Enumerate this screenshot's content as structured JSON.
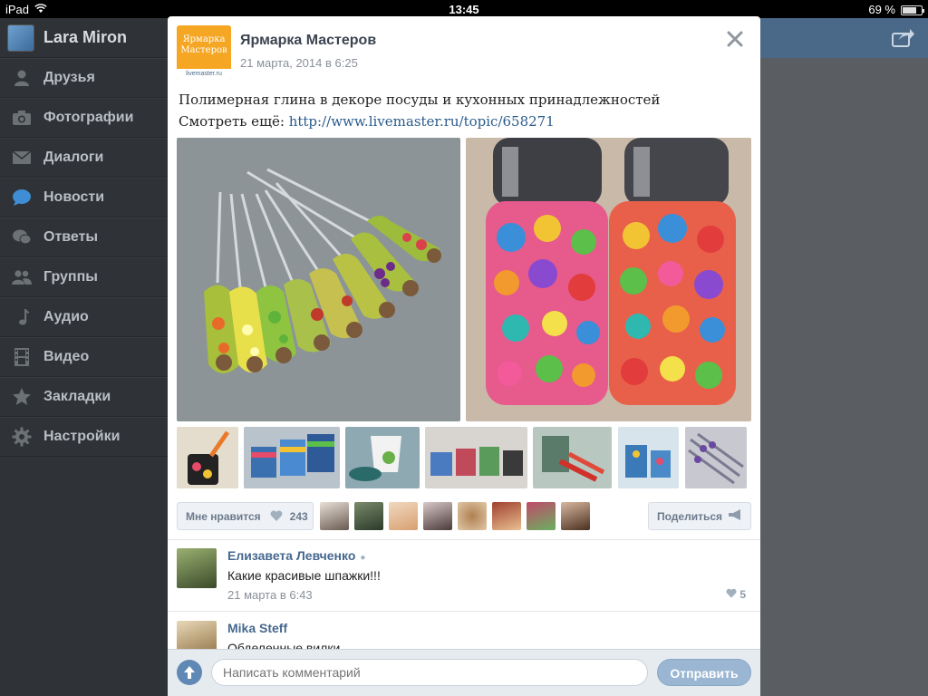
{
  "status_bar": {
    "carrier": "iPad",
    "time": "13:45",
    "battery": "69 %",
    "battery_level": 0.69
  },
  "sidebar": {
    "user_name": "Lara Miron",
    "items": [
      {
        "label": "Друзья",
        "icon": "person-icon"
      },
      {
        "label": "Фотографии",
        "icon": "camera-icon"
      },
      {
        "label": "Диалоги",
        "icon": "envelope-icon"
      },
      {
        "label": "Новости",
        "icon": "speech-bubble-icon",
        "active": true
      },
      {
        "label": "Ответы",
        "icon": "chat-bubbles-icon"
      },
      {
        "label": "Группы",
        "icon": "group-icon"
      },
      {
        "label": "Аудио",
        "icon": "music-note-icon"
      },
      {
        "label": "Видео",
        "icon": "film-icon"
      },
      {
        "label": "Закладки",
        "icon": "star-icon"
      },
      {
        "label": "Настройки",
        "icon": "gear-icon"
      }
    ]
  },
  "post": {
    "group_name": "Ярмарка Мастеров",
    "logo_text": "Ярмарка Мастеров",
    "logo_url_text": "livemaster.ru",
    "date": "21 марта, 2014 в 6:25",
    "text_line1": "Полимерная глина в декоре посуды и кухонных принадлежностей",
    "text_line2_prefix": "Смотреть ещё: ",
    "link": "http://www.livemaster.ru/topic/658271",
    "like_label": "Мне нравится",
    "like_count": "243",
    "share_label": "Поделиться"
  },
  "comments": [
    {
      "author": "Елизавета Левченко",
      "text": "Какие красивые шпажки!!!",
      "date": "21 марта в 6:43",
      "likes": "5",
      "online": true
    },
    {
      "author": "Mika Steff",
      "text": "Обделенные вилки",
      "date": "",
      "likes": "",
      "online": false
    }
  ],
  "composer": {
    "placeholder": "Написать комментарий",
    "send_label": "Отправить"
  },
  "colors": {
    "accent": "#45688e",
    "link": "#2b5c8d",
    "topbar": "#4a6988"
  }
}
